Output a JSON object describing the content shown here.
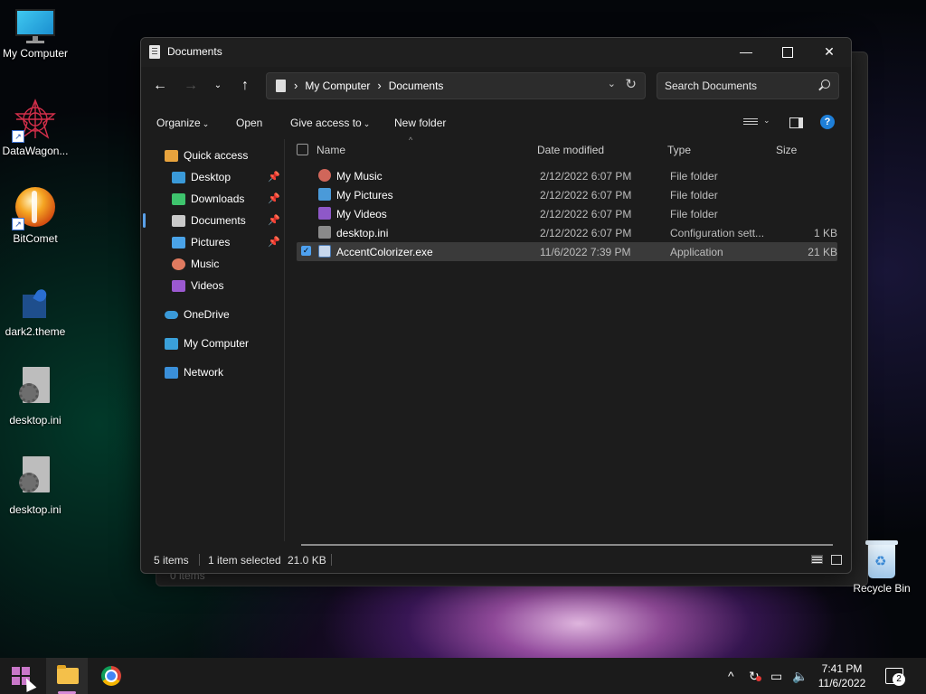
{
  "desktop": {
    "icons": [
      {
        "label": "My Computer"
      },
      {
        "label": "DataWagon..."
      },
      {
        "label": "BitComet"
      },
      {
        "label": "dark2.theme"
      },
      {
        "label": "desktop.ini"
      },
      {
        "label": "desktop.ini"
      }
    ],
    "recycle_bin": "Recycle Bin",
    "background_status": "0 items"
  },
  "window": {
    "title": "Documents",
    "controls": {
      "minimize": "—",
      "maximize": "",
      "close": "✕"
    },
    "address": {
      "crumbs": [
        "My Computer",
        "Documents"
      ],
      "separator": "›"
    },
    "search_placeholder": "Search Documents",
    "commands": {
      "organize": "Organize",
      "open": "Open",
      "give_access": "Give access to",
      "new_folder": "New folder",
      "help": "?"
    },
    "sidebar": [
      {
        "label": "Quick access",
        "icon": "star-icon",
        "color": "#e8a33d"
      },
      {
        "label": "Desktop",
        "icon": "desktop-icon",
        "color": "#3a9ad9",
        "pinned": true
      },
      {
        "label": "Downloads",
        "icon": "download-icon",
        "color": "#3ec46d",
        "pinned": true
      },
      {
        "label": "Documents",
        "icon": "documents-icon",
        "color": "#c9c9c9",
        "pinned": true,
        "selected": true
      },
      {
        "label": "Pictures",
        "icon": "pictures-icon",
        "color": "#4aa3e8",
        "pinned": true
      },
      {
        "label": "Music",
        "icon": "music-icon",
        "color": "#e07a5f"
      },
      {
        "label": "Videos",
        "icon": "videos-icon",
        "color": "#9b59d0"
      },
      {
        "label": "OneDrive",
        "icon": "onedrive-icon",
        "color": "#3a9ad9"
      },
      {
        "label": "My Computer",
        "icon": "computer-icon",
        "color": "#3aa0d9"
      },
      {
        "label": "Network",
        "icon": "network-icon",
        "color": "#3a8fd9"
      }
    ],
    "columns": {
      "name": "Name",
      "date": "Date modified",
      "type": "Type",
      "size": "Size"
    },
    "files": [
      {
        "name": "My Music",
        "date": "2/12/2022 6:07 PM",
        "type": "File folder",
        "size": "",
        "icon": "music-folder-icon",
        "color": "#d0665a"
      },
      {
        "name": "My Pictures",
        "date": "2/12/2022 6:07 PM",
        "type": "File folder",
        "size": "",
        "icon": "pictures-folder-icon",
        "color": "#4a9ad9"
      },
      {
        "name": "My Videos",
        "date": "2/12/2022 6:07 PM",
        "type": "File folder",
        "size": "",
        "icon": "videos-folder-icon",
        "color": "#8e58c8"
      },
      {
        "name": "desktop.ini",
        "date": "2/12/2022 6:07 PM",
        "type": "Configuration sett...",
        "size": "1 KB",
        "icon": "settings-file-icon",
        "color": "#8a8a8a"
      },
      {
        "name": "AccentColorizer.exe",
        "date": "11/6/2022 7:39 PM",
        "type": "Application",
        "size": "21 KB",
        "icon": "application-icon",
        "color": "#c8d8ec",
        "selected": true
      }
    ],
    "status": {
      "count": "5 items",
      "selected": "1 item selected",
      "size": "21.0 KB"
    }
  },
  "taskbar": {
    "time": "7:41 PM",
    "date": "11/6/2022",
    "notification_count": "2"
  }
}
